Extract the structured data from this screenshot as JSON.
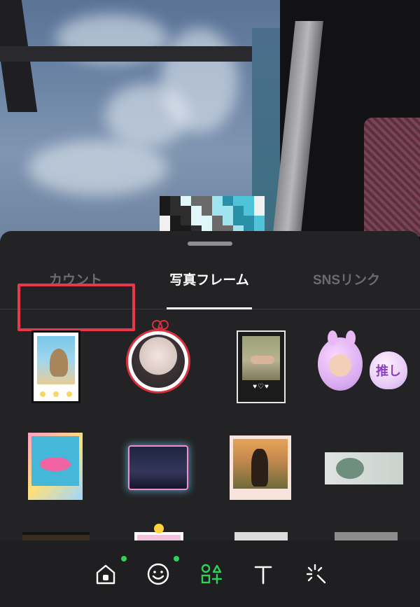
{
  "tabs": {
    "count": "カウント",
    "photo_frame": "写真フレーム",
    "sns_link": "SNSリンク",
    "selected": "写真フレーム"
  },
  "frames": {
    "heart_balloon_text": "推し",
    "hearts_caption": "♥♡♥"
  },
  "toolbar": {
    "items": [
      "home-sticker",
      "emoji",
      "shapes",
      "text",
      "effects"
    ],
    "selected": "shapes",
    "badge_color": "#2fd158"
  },
  "colors": {
    "highlight": "#e8394a",
    "active_tab": "#ffffff",
    "inactive_tab": "#6b6b70",
    "selected_tool": "#2fd158"
  }
}
